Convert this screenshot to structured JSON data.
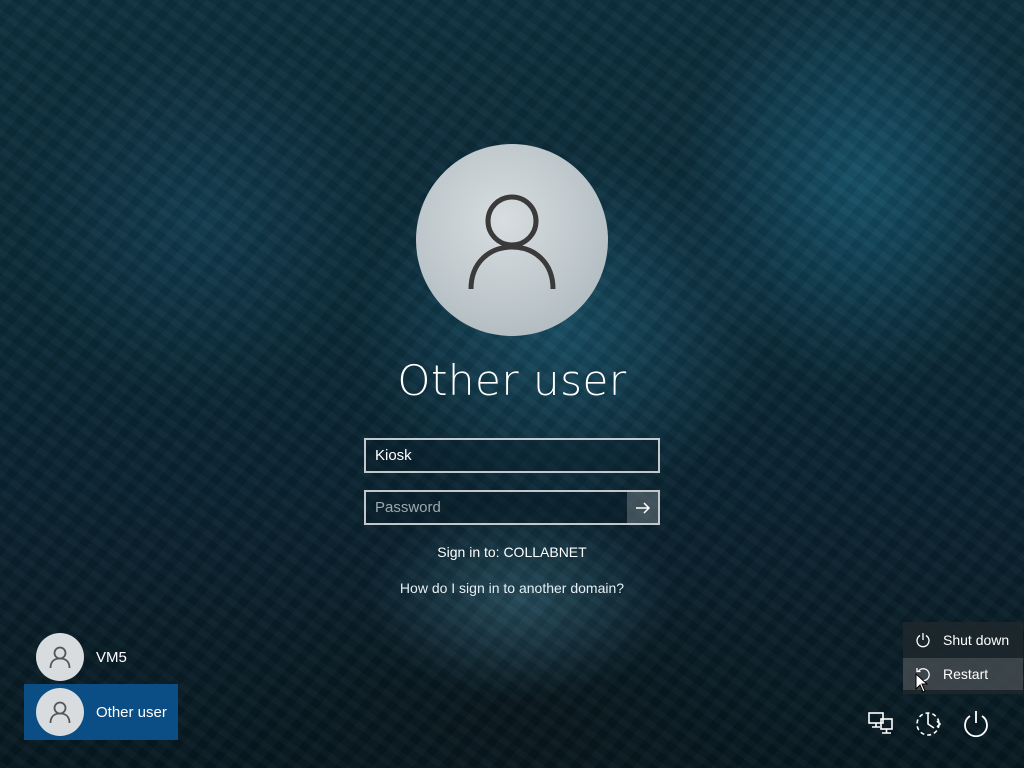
{
  "login": {
    "selected_user": "Other user",
    "username_value": "Kiosk",
    "password_placeholder": "Password",
    "sign_in_to": "Sign in to: COLLABNET",
    "other_domain_link": "How do I sign in to another domain?"
  },
  "user_list": [
    {
      "name": "VM5",
      "selected": false
    },
    {
      "name": "Other user",
      "selected": true
    }
  ],
  "power_menu": {
    "items": [
      {
        "label": "Shut down",
        "icon": "power-icon"
      },
      {
        "label": "Restart",
        "icon": "restart-icon"
      }
    ],
    "highlighted": "Restart"
  },
  "bottom_bar": {
    "icons": [
      "network-icon",
      "accessibility-icon",
      "power-icon"
    ]
  },
  "colors": {
    "selected_tile": "#0a4e85",
    "text": "#ffffff"
  }
}
